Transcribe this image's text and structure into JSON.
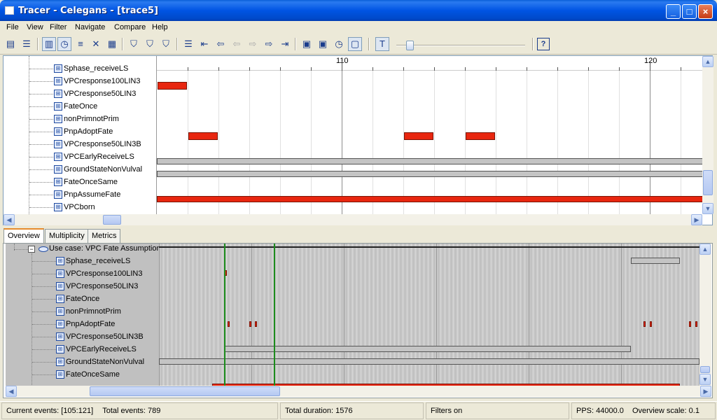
{
  "window": {
    "title": "Tracer - Celegans - [trace5]"
  },
  "menu": [
    "File",
    "View",
    "Filter",
    "Navigate",
    "Compare",
    "Help"
  ],
  "toolbar": {
    "help_label": "?"
  },
  "timeline": {
    "tick_110": "110",
    "tick_120": "120"
  },
  "top_rows": [
    {
      "label": "Sphase_receiveLS"
    },
    {
      "label": "VPCresponse100LIN3"
    },
    {
      "label": "VPCresponse50LIN3"
    },
    {
      "label": "FateOnce"
    },
    {
      "label": "nonPrimnotPrim"
    },
    {
      "label": "PnpAdoptFate"
    },
    {
      "label": "VPCresponse50LIN3B"
    },
    {
      "label": "VPCEarlyReceiveLS"
    },
    {
      "label": "GroundStateNonVulval"
    },
    {
      "label": "FateOnceSame"
    },
    {
      "label": "PnpAssumeFate"
    },
    {
      "label": "VPCborn"
    }
  ],
  "tabs": [
    "Overview",
    "Multiplicity",
    "Metrics"
  ],
  "overview": {
    "use_case": "Use case: VPC Fate Assumption",
    "rows": [
      {
        "label": "Sphase_receiveLS"
      },
      {
        "label": "VPCresponse100LIN3"
      },
      {
        "label": "VPCresponse50LIN3"
      },
      {
        "label": "FateOnce"
      },
      {
        "label": "nonPrimnotPrim"
      },
      {
        "label": "PnpAdoptFate"
      },
      {
        "label": "VPCresponse50LIN3B"
      },
      {
        "label": "VPCEarlyReceiveLS"
      },
      {
        "label": "GroundStateNonVulval"
      },
      {
        "label": "FateOnceSame"
      }
    ]
  },
  "status": {
    "current_events": "Current events: [105:121]",
    "total_events": "Total events: 789",
    "total_duration": "Total duration: 1576",
    "filters": "Filters on",
    "pps": "PPS: 44000.0",
    "overview_scale": "Overview scale: 0.1"
  },
  "colors": {
    "titlebar": "#0054e3",
    "event_red": "#e8260f",
    "event_gray": "#c4c4c4",
    "window_marker": "#1c8c1c",
    "tab_accent": "#e68b2c"
  }
}
